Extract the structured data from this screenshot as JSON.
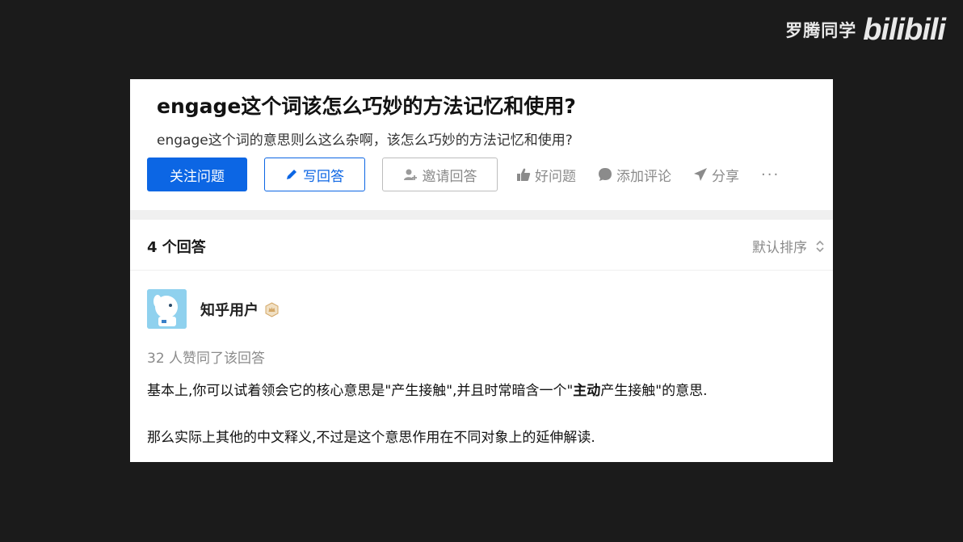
{
  "watermark": {
    "name": "罗腾同学",
    "logo": "bilibili"
  },
  "question": {
    "title": "engage这个词该怎么巧妙的方法记忆和使用?",
    "description": "engage这个词的意思则么这么杂啊，该怎么巧妙的方法记忆和使用?"
  },
  "actions": {
    "follow": "关注问题",
    "write": "写回答",
    "invite": "邀请回答",
    "good_question": "好问题",
    "comment": "添加评论",
    "share": "分享",
    "more": "···"
  },
  "answers_header": {
    "count": "4 个回答",
    "sort": "默认排序"
  },
  "answer": {
    "author": "知乎用户",
    "votes": "32 人赞同了该回答",
    "p1_before": "基本上,你可以试着领会它的核心意思是\"产生接触\",并且时常暗含一个\"",
    "p1_bold": "主动",
    "p1_after": "产生接触\"的意思.",
    "p2": "那么实际上其他的中文释义,不过是这个意思作用在不同对象上的延伸解读."
  },
  "colors": {
    "accent": "#0c66e4",
    "muted": "#8b8b8b",
    "background": "#1b1b1b"
  },
  "icons": [
    "pencil-icon",
    "invite-user-icon",
    "thumbs-up-icon",
    "comment-bubble-icon",
    "share-arrow-icon",
    "sort-chevrons-icon",
    "verified-badge-icon"
  ]
}
